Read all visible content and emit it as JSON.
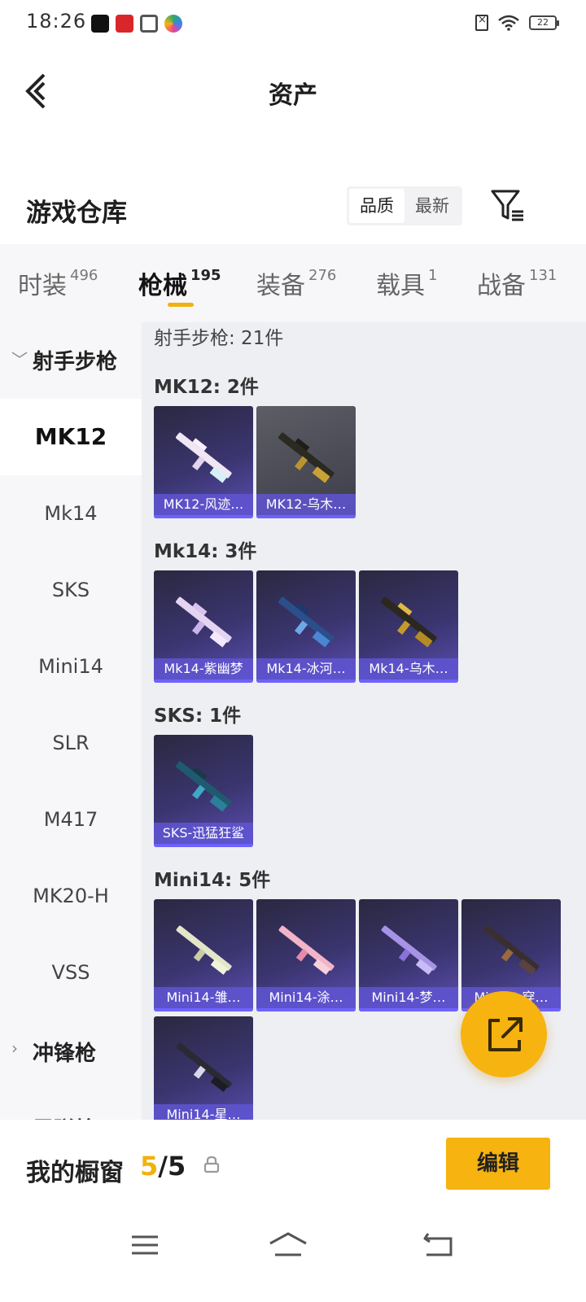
{
  "status_bar": {
    "time": "18:26",
    "battery": "22",
    "app_icons": [
      "tiktok-icon",
      "tmall-icon",
      "wallet-icon",
      "colorful-app-icon"
    ],
    "app_colors": [
      "#111111",
      "#d9262b",
      "#555555",
      "#2ea86a"
    ]
  },
  "header": {
    "title": "资产",
    "back_icon": "chevron-left-icon"
  },
  "warehouse": {
    "title": "游戏仓库",
    "sort_options": [
      "品质",
      "最新"
    ],
    "sort_active": "品质",
    "filter_icon": "filter-list-icon"
  },
  "tabs": [
    {
      "label": "时装",
      "count": "496"
    },
    {
      "label": "枪械",
      "count": "195",
      "active": true
    },
    {
      "label": "装备",
      "count": "276"
    },
    {
      "label": "载具",
      "count": "1"
    },
    {
      "label": "战备",
      "count": "131"
    }
  ],
  "sidebar": {
    "categories": [
      {
        "label": "射手步枪",
        "expanded": true
      },
      {
        "label": "冲锋枪",
        "expanded": false
      },
      {
        "label": "霰弹枪",
        "expanded": false
      }
    ],
    "items": [
      "MK12",
      "Mk14",
      "SKS",
      "Mini14",
      "SLR",
      "M417",
      "MK20-H",
      "VSS"
    ],
    "active_item": "MK12"
  },
  "content": {
    "summary": "射手步枪: 21件",
    "sections": [
      {
        "title": "MK12: 2件",
        "cards": [
          "MK12-风迹…",
          "MK12-乌木…"
        ]
      },
      {
        "title": "Mk14: 3件",
        "cards": [
          "Mk14-紫幽梦",
          "Mk14-冰河…",
          "Mk14-乌木…"
        ]
      },
      {
        "title": "SKS: 1件",
        "cards": [
          "SKS-迅猛狂鲨"
        ]
      },
      {
        "title": "Mini14: 5件",
        "cards": [
          "Mini14-雏…",
          "Mini14-涂…",
          "Mini14-梦…",
          "Mini14-穿…",
          "Mini14-星…"
        ]
      }
    ]
  },
  "fab": {
    "icon": "share-external-icon"
  },
  "showcase": {
    "label": "我的橱窗",
    "current": "5",
    "separator": "/",
    "total": "5",
    "lock_icon": "lock-icon",
    "edit_label": "编辑"
  },
  "nav_bar": {
    "icons": [
      "menu-icon",
      "home-icon",
      "back-icon"
    ]
  },
  "colors": {
    "accent": "#f7b30f",
    "card_purple": "#5b4fb3",
    "card_label": "#5f55d2"
  }
}
